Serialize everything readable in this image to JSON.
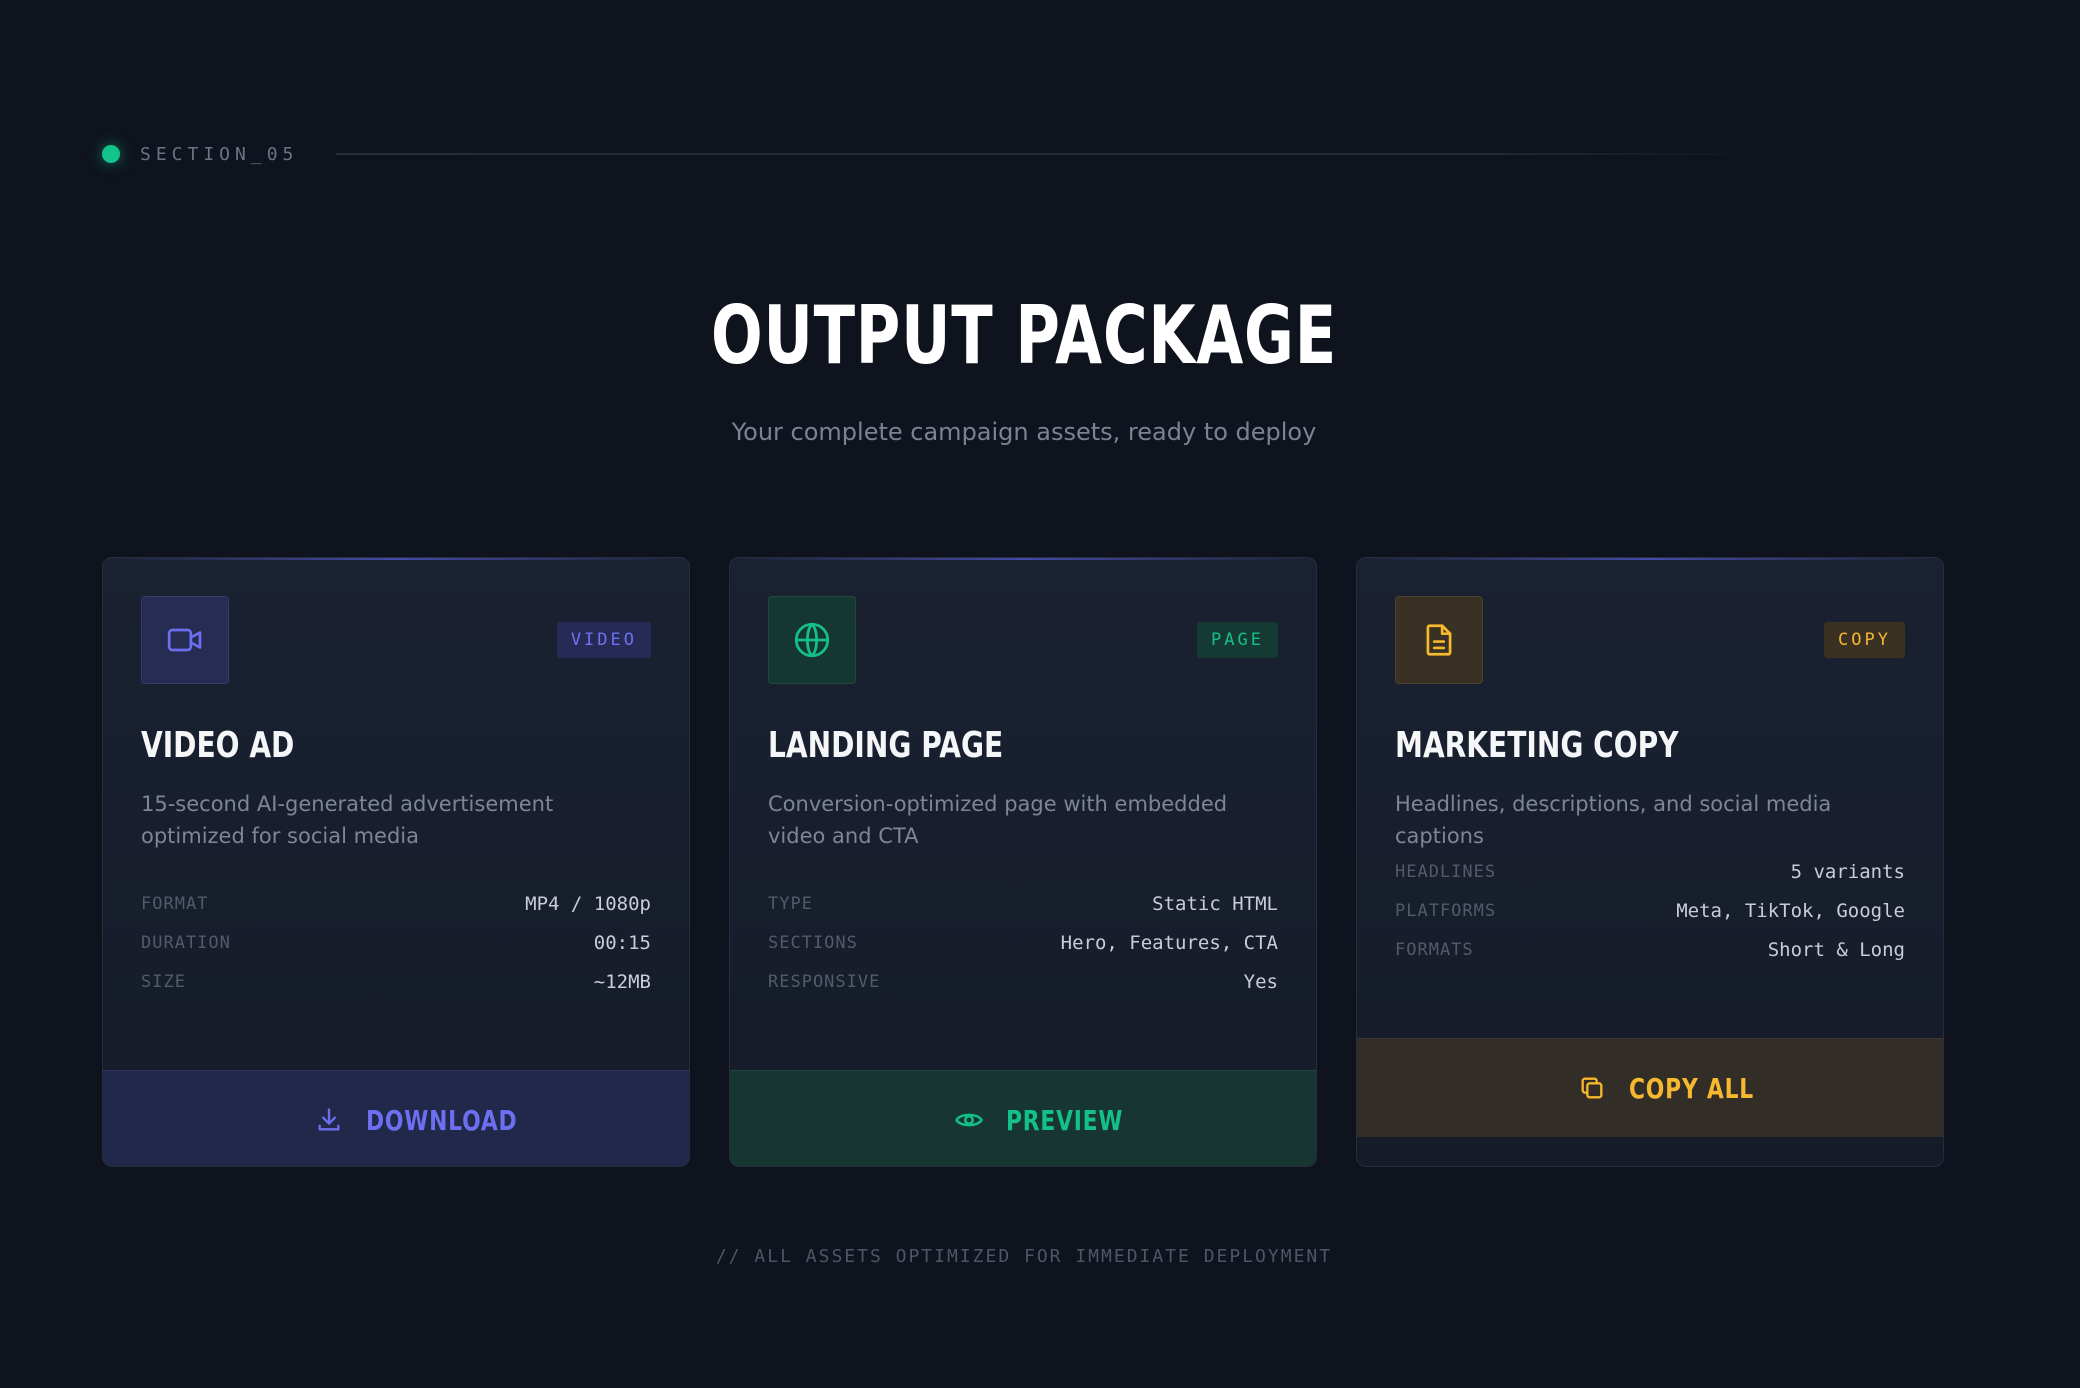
{
  "section": {
    "label": "SECTION_05"
  },
  "header": {
    "title": "OUTPUT PACKAGE",
    "subtitle": "Your complete campaign assets, ready to deploy"
  },
  "cards": [
    {
      "icon": "video-camera-icon",
      "badge": "VIDEO",
      "title": "VIDEO AD",
      "description": "15-second AI-generated advertisement optimized for social media",
      "specs": [
        {
          "key": "FORMAT",
          "value": "MP4 / 1080p"
        },
        {
          "key": "DURATION",
          "value": "00:15"
        },
        {
          "key": "SIZE",
          "value": "~12MB"
        }
      ],
      "action": {
        "label": "DOWNLOAD",
        "icon": "download-icon"
      },
      "accent": "#6366f1"
    },
    {
      "icon": "globe-icon",
      "badge": "PAGE",
      "title": "LANDING PAGE",
      "description": "Conversion-optimized page with embedded video and CTA",
      "specs": [
        {
          "key": "TYPE",
          "value": "Static HTML"
        },
        {
          "key": "SECTIONS",
          "value": "Hero, Features, CTA"
        },
        {
          "key": "RESPONSIVE",
          "value": "Yes"
        }
      ],
      "action": {
        "label": "PREVIEW",
        "icon": "eye-icon"
      },
      "accent": "#10b981"
    },
    {
      "icon": "document-icon",
      "badge": "COPY",
      "title": "MARKETING COPY",
      "description": "Headlines, descriptions, and social media captions",
      "specs": [
        {
          "key": "HEADLINES",
          "value": "5 variants"
        },
        {
          "key": "PLATFORMS",
          "value": "Meta, TikTok, Google"
        },
        {
          "key": "FORMATS",
          "value": "Short & Long"
        }
      ],
      "action": {
        "label": "COPY ALL",
        "icon": "copy-icon"
      },
      "accent": "#f5b82e"
    }
  ],
  "footer": {
    "note": "// ALL ASSETS OPTIMIZED FOR IMMEDIATE DEPLOYMENT"
  },
  "colors": {
    "background": "#0f131d",
    "section_dot": "#12c48b",
    "video_accent": "#6366f1",
    "page_accent": "#10b981",
    "copy_accent": "#f5b82e"
  }
}
